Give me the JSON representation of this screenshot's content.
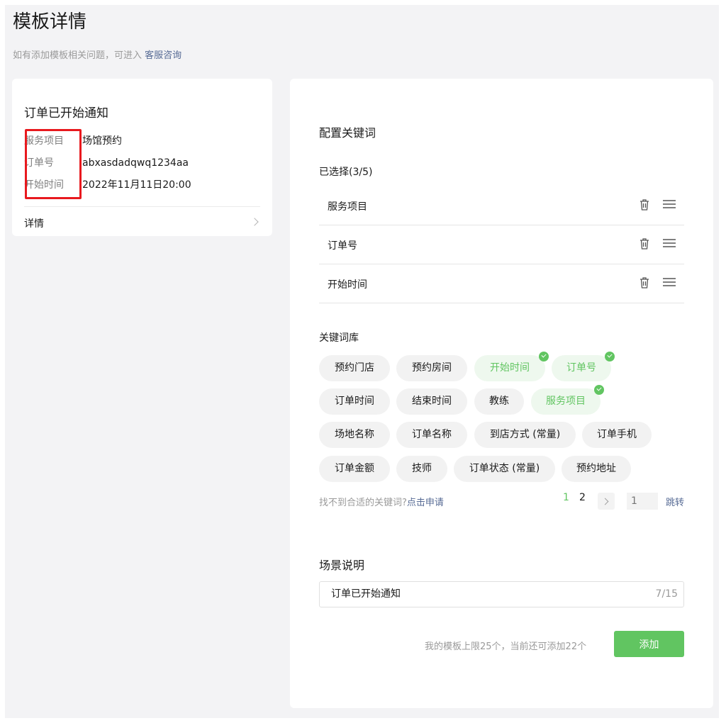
{
  "header": {
    "title": "模板详情",
    "subtitle_prefix": "如有添加模板相关问题，可进入",
    "subtitle_link": "客服咨询"
  },
  "preview": {
    "title": "订单已开始通知",
    "rows": [
      {
        "key": "服务项目",
        "value": "场馆预约"
      },
      {
        "key": "订单号",
        "value": "abxasdadqwq1234aa"
      },
      {
        "key": "开始时间",
        "value": "2022年11月11日20:00"
      }
    ],
    "detail_label": "详情"
  },
  "config": {
    "title": "配置关键词",
    "selected_title": "已选择(3/5)",
    "selected": [
      "服务项目",
      "订单号",
      "开始时间"
    ],
    "library_title": "关键词库",
    "library": [
      {
        "label": "预约门店",
        "selected": false
      },
      {
        "label": "预约房间",
        "selected": false
      },
      {
        "label": "开始时间",
        "selected": true
      },
      {
        "label": "订单号",
        "selected": true
      },
      {
        "label": "订单时间",
        "selected": false
      },
      {
        "label": "结束时间",
        "selected": false
      },
      {
        "label": "教练",
        "selected": false
      },
      {
        "label": "服务项目",
        "selected": true
      },
      {
        "label": "场地名称",
        "selected": false
      },
      {
        "label": "订单名称",
        "selected": false
      },
      {
        "label": "到店方式 (常量)",
        "selected": false
      },
      {
        "label": "订单手机",
        "selected": false
      },
      {
        "label": "订单金额",
        "selected": false
      },
      {
        "label": "技师",
        "selected": false
      },
      {
        "label": "订单状态 (常量)",
        "selected": false
      },
      {
        "label": "预约地址",
        "selected": false
      }
    ],
    "help_prefix": "找不到合适的关键词?",
    "help_link": "点击申请",
    "pagination": {
      "page1": "1",
      "page2": "2",
      "input_placeholder": "1",
      "jump_label": "跳转"
    },
    "scene_title": "场景说明",
    "scene_value": "订单已开始通知",
    "scene_count": "7/15",
    "limit_text": "我的模板上限25个，当前还可添加22个",
    "add_label": "添加"
  },
  "colors": {
    "accent": "#61c561",
    "link": "#576b95",
    "highlight": "#e8191e"
  }
}
